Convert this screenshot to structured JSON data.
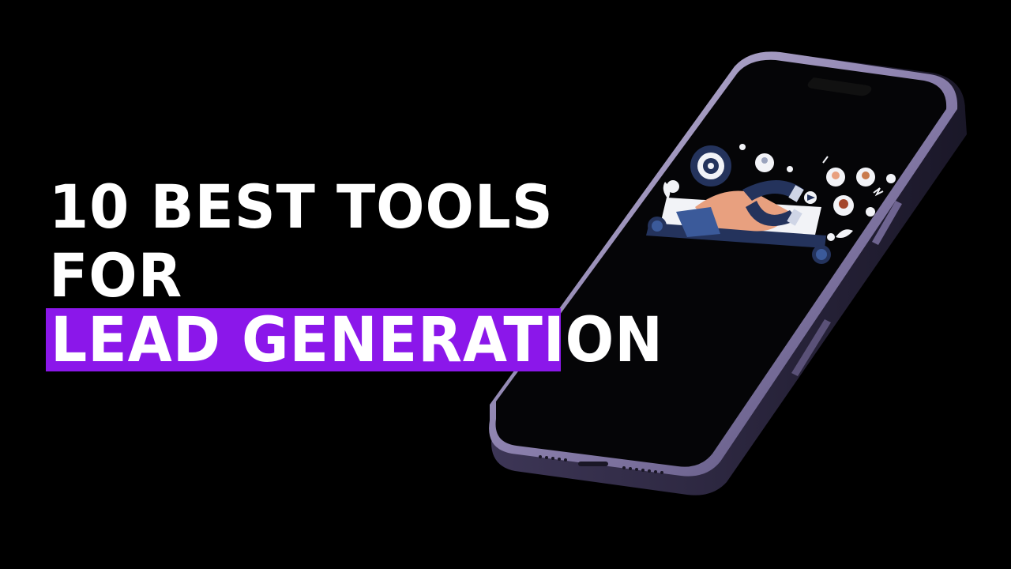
{
  "headline": {
    "line1": "10 BEST TOOLS",
    "line2": "FOR",
    "line3": "LEAD GENERATION"
  },
  "colors": {
    "background": "#000000",
    "text": "#ffffff",
    "highlight": "#8b17ea",
    "phone_frame": "#9a8fb8",
    "illustration_navy": "#24335c"
  },
  "icons": {
    "phone": "smartphone-icon",
    "illustration": "magnet-lead-illustration",
    "target": "target-icon",
    "coin": "dollar-coin-icon"
  }
}
